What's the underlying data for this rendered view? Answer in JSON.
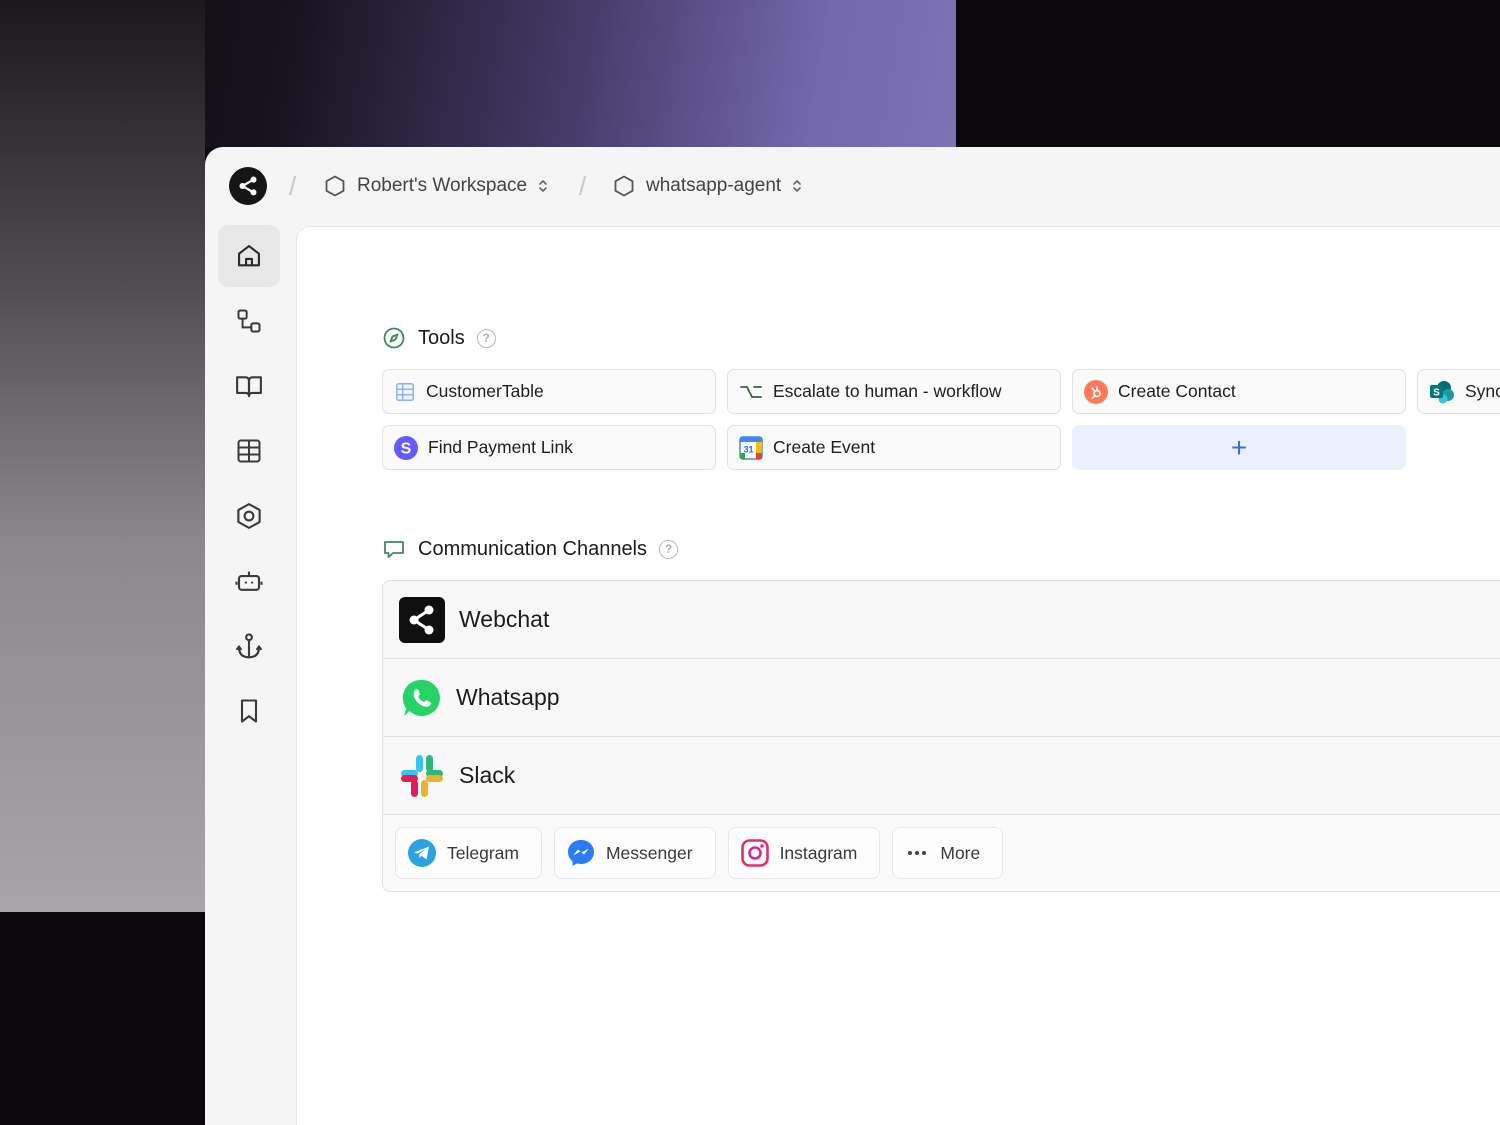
{
  "breadcrumb": {
    "workspace": "Robert's Workspace",
    "agent": "whatsapp-agent"
  },
  "sidebar": {
    "items": [
      {
        "icon": "home-icon",
        "active": true
      },
      {
        "icon": "flow-icon"
      },
      {
        "icon": "book-icon"
      },
      {
        "icon": "table-icon"
      },
      {
        "icon": "hexagon-settings-icon"
      },
      {
        "icon": "bot-icon"
      },
      {
        "icon": "anchor-icon"
      },
      {
        "icon": "bookmark-icon"
      }
    ]
  },
  "tools": {
    "title": "Tools",
    "items": [
      {
        "label": "CustomerTable",
        "icon": "table-icon"
      },
      {
        "label": "Escalate to human - workflow",
        "icon": "workflow-icon"
      },
      {
        "label": "Create Contact",
        "icon": "hubspot-icon"
      },
      {
        "label": "Sync",
        "icon": "sharepoint-icon"
      },
      {
        "label": "Find Payment Link",
        "icon": "stripe-icon"
      },
      {
        "label": "Create Event",
        "icon": "google-calendar-icon"
      }
    ],
    "add_label": "+"
  },
  "channels": {
    "title": "Communication Channels",
    "rows": [
      {
        "label": "Webchat",
        "icon": "webchat-icon"
      },
      {
        "label": "Whatsapp",
        "icon": "whatsapp-icon"
      },
      {
        "label": "Slack",
        "icon": "slack-icon"
      }
    ],
    "pills": [
      {
        "label": "Telegram",
        "icon": "telegram-icon"
      },
      {
        "label": "Messenger",
        "icon": "messenger-icon"
      },
      {
        "label": "Instagram",
        "icon": "instagram-icon"
      },
      {
        "label": "More",
        "icon": "more-icon"
      }
    ]
  },
  "calendar_day": "31",
  "colors": {
    "accent": "#3b6fd6",
    "whatsapp": "#25d366",
    "hubspot": "#ff7a59",
    "stripe": "#635bff",
    "telegram": "#2aa3e0"
  }
}
